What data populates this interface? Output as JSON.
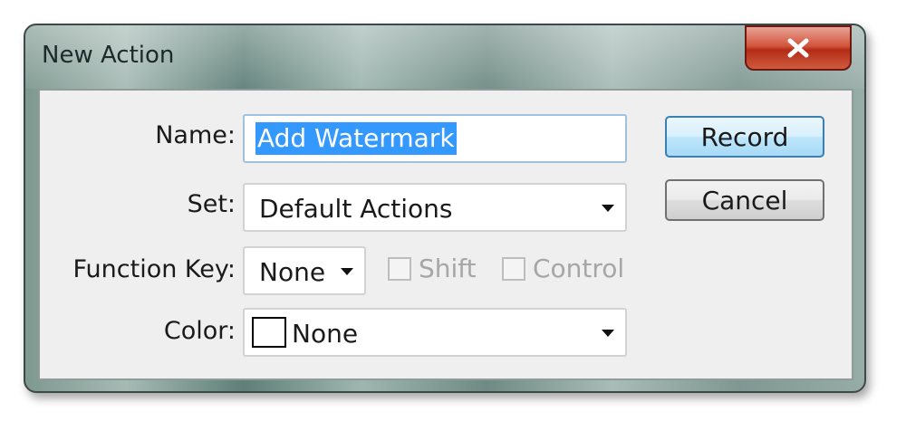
{
  "window": {
    "title": "New Action",
    "close_icon": "close-icon"
  },
  "form": {
    "name": {
      "label": "Name:",
      "value": "Add Watermark"
    },
    "set": {
      "label": "Set:",
      "value": "Default Actions"
    },
    "function_key": {
      "label": "Function Key:",
      "value": "None",
      "shift_label": "Shift",
      "control_label": "Control",
      "shift_checked": false,
      "control_checked": false
    },
    "color": {
      "label": "Color:",
      "value": "None"
    }
  },
  "buttons": {
    "record": "Record",
    "cancel": "Cancel"
  },
  "colors": {
    "selection": "#3399ff",
    "record_border": "#3c7fb1",
    "close_button": "#c8432b"
  }
}
